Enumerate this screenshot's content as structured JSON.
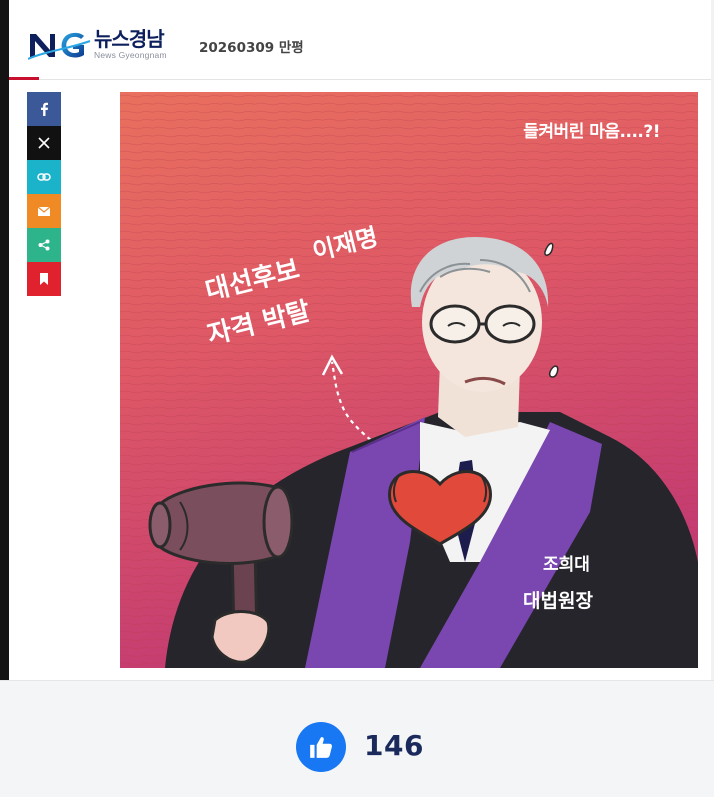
{
  "header": {
    "logo_ko": "뉴스경남",
    "logo_en": "News Gyeongnam",
    "title": "20260309 만평"
  },
  "share": {
    "buttons": [
      {
        "name": "facebook",
        "color": "#3b5998"
      },
      {
        "name": "x",
        "color": "#111111"
      },
      {
        "name": "link",
        "color": "#1bb3c9"
      },
      {
        "name": "email",
        "color": "#f08a24"
      },
      {
        "name": "share",
        "color": "#2db48a"
      },
      {
        "name": "bookmark",
        "color": "#e0222e"
      }
    ]
  },
  "cartoon": {
    "caption_top": "들켜버린 마음....?!",
    "speech_line1": "이재명",
    "speech_line2": "대선후보",
    "speech_line3": "자격 박탈",
    "label_line1": "조희대",
    "label_line2": "대법원장"
  },
  "reaction": {
    "like_count": "146"
  }
}
